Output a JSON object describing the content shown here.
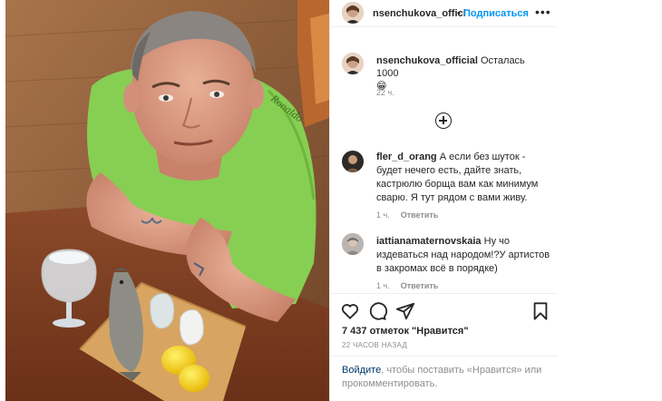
{
  "colors": {
    "accent": "#0095f6",
    "link": "#00376b",
    "muted": "#8e8e8e",
    "text": "#262626"
  },
  "header": {
    "username": "nsenchukova_offici",
    "separator": "•",
    "follow_label": "Подписаться",
    "more_icon": "more-horizontal-icon",
    "more_glyph": "•••"
  },
  "caption": {
    "username": "nsenchukova_official",
    "text": "Осталась 1000",
    "emoji": "😁",
    "time": "22 ч."
  },
  "load_more_icon": "plus-circle-icon",
  "comments": [
    {
      "username": "fler_d_orang",
      "text": "А если без шуток - будет нечего есть, дайте знать, кастрюлю борща вам как минимум сварю. Я тут рядом с вами живу.",
      "time": "1 ч.",
      "reply_label": "Ответить"
    },
    {
      "username": "iattianamaternovskaia",
      "text": "Ну чо издеваться над народом!?У артистов в закромах всё в порядке)",
      "time": "1 ч.",
      "reply_label": "Ответить"
    }
  ],
  "actions": {
    "icons": [
      "heart-icon",
      "comment-icon",
      "share-icon",
      "bookmark-icon"
    ],
    "likes": "7 437 отметок \"Нравится\"",
    "post_time": "22 ЧАСОВ НАЗАД"
  },
  "login_prompt": {
    "link": "Войдите",
    "text": ", чтобы поставить «Нравится» или прокомментировать."
  }
}
